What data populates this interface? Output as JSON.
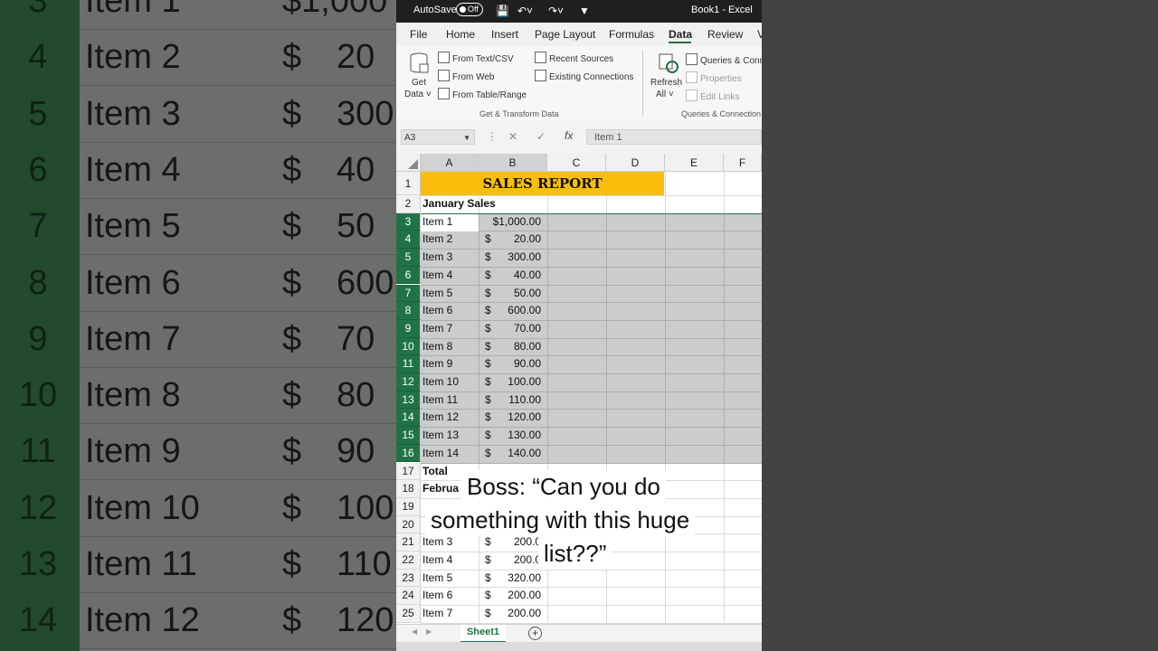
{
  "window": {
    "autosave_label": "AutoSave",
    "autosave_state": "Off",
    "title": "Book1  -  Excel"
  },
  "tabs": [
    "File",
    "Home",
    "Insert",
    "Page Layout",
    "Formulas",
    "Data",
    "Review",
    "V"
  ],
  "active_tab": "Data",
  "ribbon": {
    "get_data_top": "Get",
    "get_data_bottom": "Data ˅",
    "from_text_csv": "From Text/CSV",
    "from_web": "From Web",
    "from_table_range": "From Table/Range",
    "recent_sources": "Recent Sources",
    "existing_connections": "Existing Connections",
    "group_get_transform": "Get & Transform Data",
    "refresh_top": "Refresh",
    "refresh_bottom": "All ˅",
    "queries_connections": "Queries & Conn",
    "properties": "Properties",
    "edit_links": "Edit Links",
    "group_queries": "Queries & Connection"
  },
  "formula_bar": {
    "name_box": "A3",
    "fx": "fx",
    "content": "Item 1"
  },
  "columns": [
    "A",
    "B",
    "C",
    "D",
    "E",
    "F"
  ],
  "rows": [
    "1",
    "2",
    "3",
    "4",
    "5",
    "6",
    "7",
    "8",
    "9",
    "10",
    "11",
    "12",
    "13",
    "14",
    "15",
    "16",
    "17",
    "18",
    "19",
    "20",
    "21",
    "22",
    "23",
    "24",
    "25"
  ],
  "cells": {
    "title": "SALES REPORT",
    "january_label": "January Sales",
    "total_label": "Total",
    "february_label": "Februa",
    "currency_symbol": "$",
    "items": [
      {
        "name": "Item 1",
        "amount": "$1,000.00"
      },
      {
        "name": "Item 2",
        "amount": "20.00"
      },
      {
        "name": "Item 3",
        "amount": "300.00"
      },
      {
        "name": "Item 4",
        "amount": "40.00"
      },
      {
        "name": "Item 5",
        "amount": "50.00"
      },
      {
        "name": "Item 6",
        "amount": "600.00"
      },
      {
        "name": "Item 7",
        "amount": "70.00"
      },
      {
        "name": "Item 8",
        "amount": "80.00"
      },
      {
        "name": "Item 9",
        "amount": "90.00"
      },
      {
        "name": "Item 10",
        "amount": "100.00"
      },
      {
        "name": "Item 11",
        "amount": "110.00"
      },
      {
        "name": "Item 12",
        "amount": "120.00"
      },
      {
        "name": "Item 13",
        "amount": "130.00"
      },
      {
        "name": "Item 14",
        "amount": "140.00"
      }
    ],
    "feb_items": [
      {
        "name": "Item 3",
        "amount": "200.0"
      },
      {
        "name": "Item 4",
        "amount": "200.0"
      },
      {
        "name": "Item 5",
        "amount": "320.00"
      },
      {
        "name": "Item 6",
        "amount": "200.00"
      },
      {
        "name": "Item 7",
        "amount": "200.00"
      }
    ]
  },
  "sheet_tab": "Sheet1",
  "caption": {
    "line1": "Boss: “Can you do",
    "line2": "something with this huge",
    "line3": "list??”"
  },
  "background": {
    "rows": [
      {
        "n": "3",
        "item": "Item 1",
        "val": "$1,000"
      },
      {
        "n": "4",
        "item": "Item 2",
        "val": "20"
      },
      {
        "n": "5",
        "item": "Item 3",
        "val": "300"
      },
      {
        "n": "6",
        "item": "Item 4",
        "val": "40"
      },
      {
        "n": "7",
        "item": "Item 5",
        "val": "50"
      },
      {
        "n": "8",
        "item": "Item 6",
        "val": "600"
      },
      {
        "n": "9",
        "item": "Item 7",
        "val": "70"
      },
      {
        "n": "10",
        "item": "Item 8",
        "val": "80"
      },
      {
        "n": "11",
        "item": "Item 9",
        "val": "90"
      },
      {
        "n": "12",
        "item": "Item 10",
        "val": "100"
      },
      {
        "n": "13",
        "item": "Item 11",
        "val": "110"
      },
      {
        "n": "14",
        "item": "Item 12",
        "val": "120"
      }
    ]
  },
  "colors": {
    "excel_green": "#217346",
    "title_fill": "#f9be0c"
  }
}
